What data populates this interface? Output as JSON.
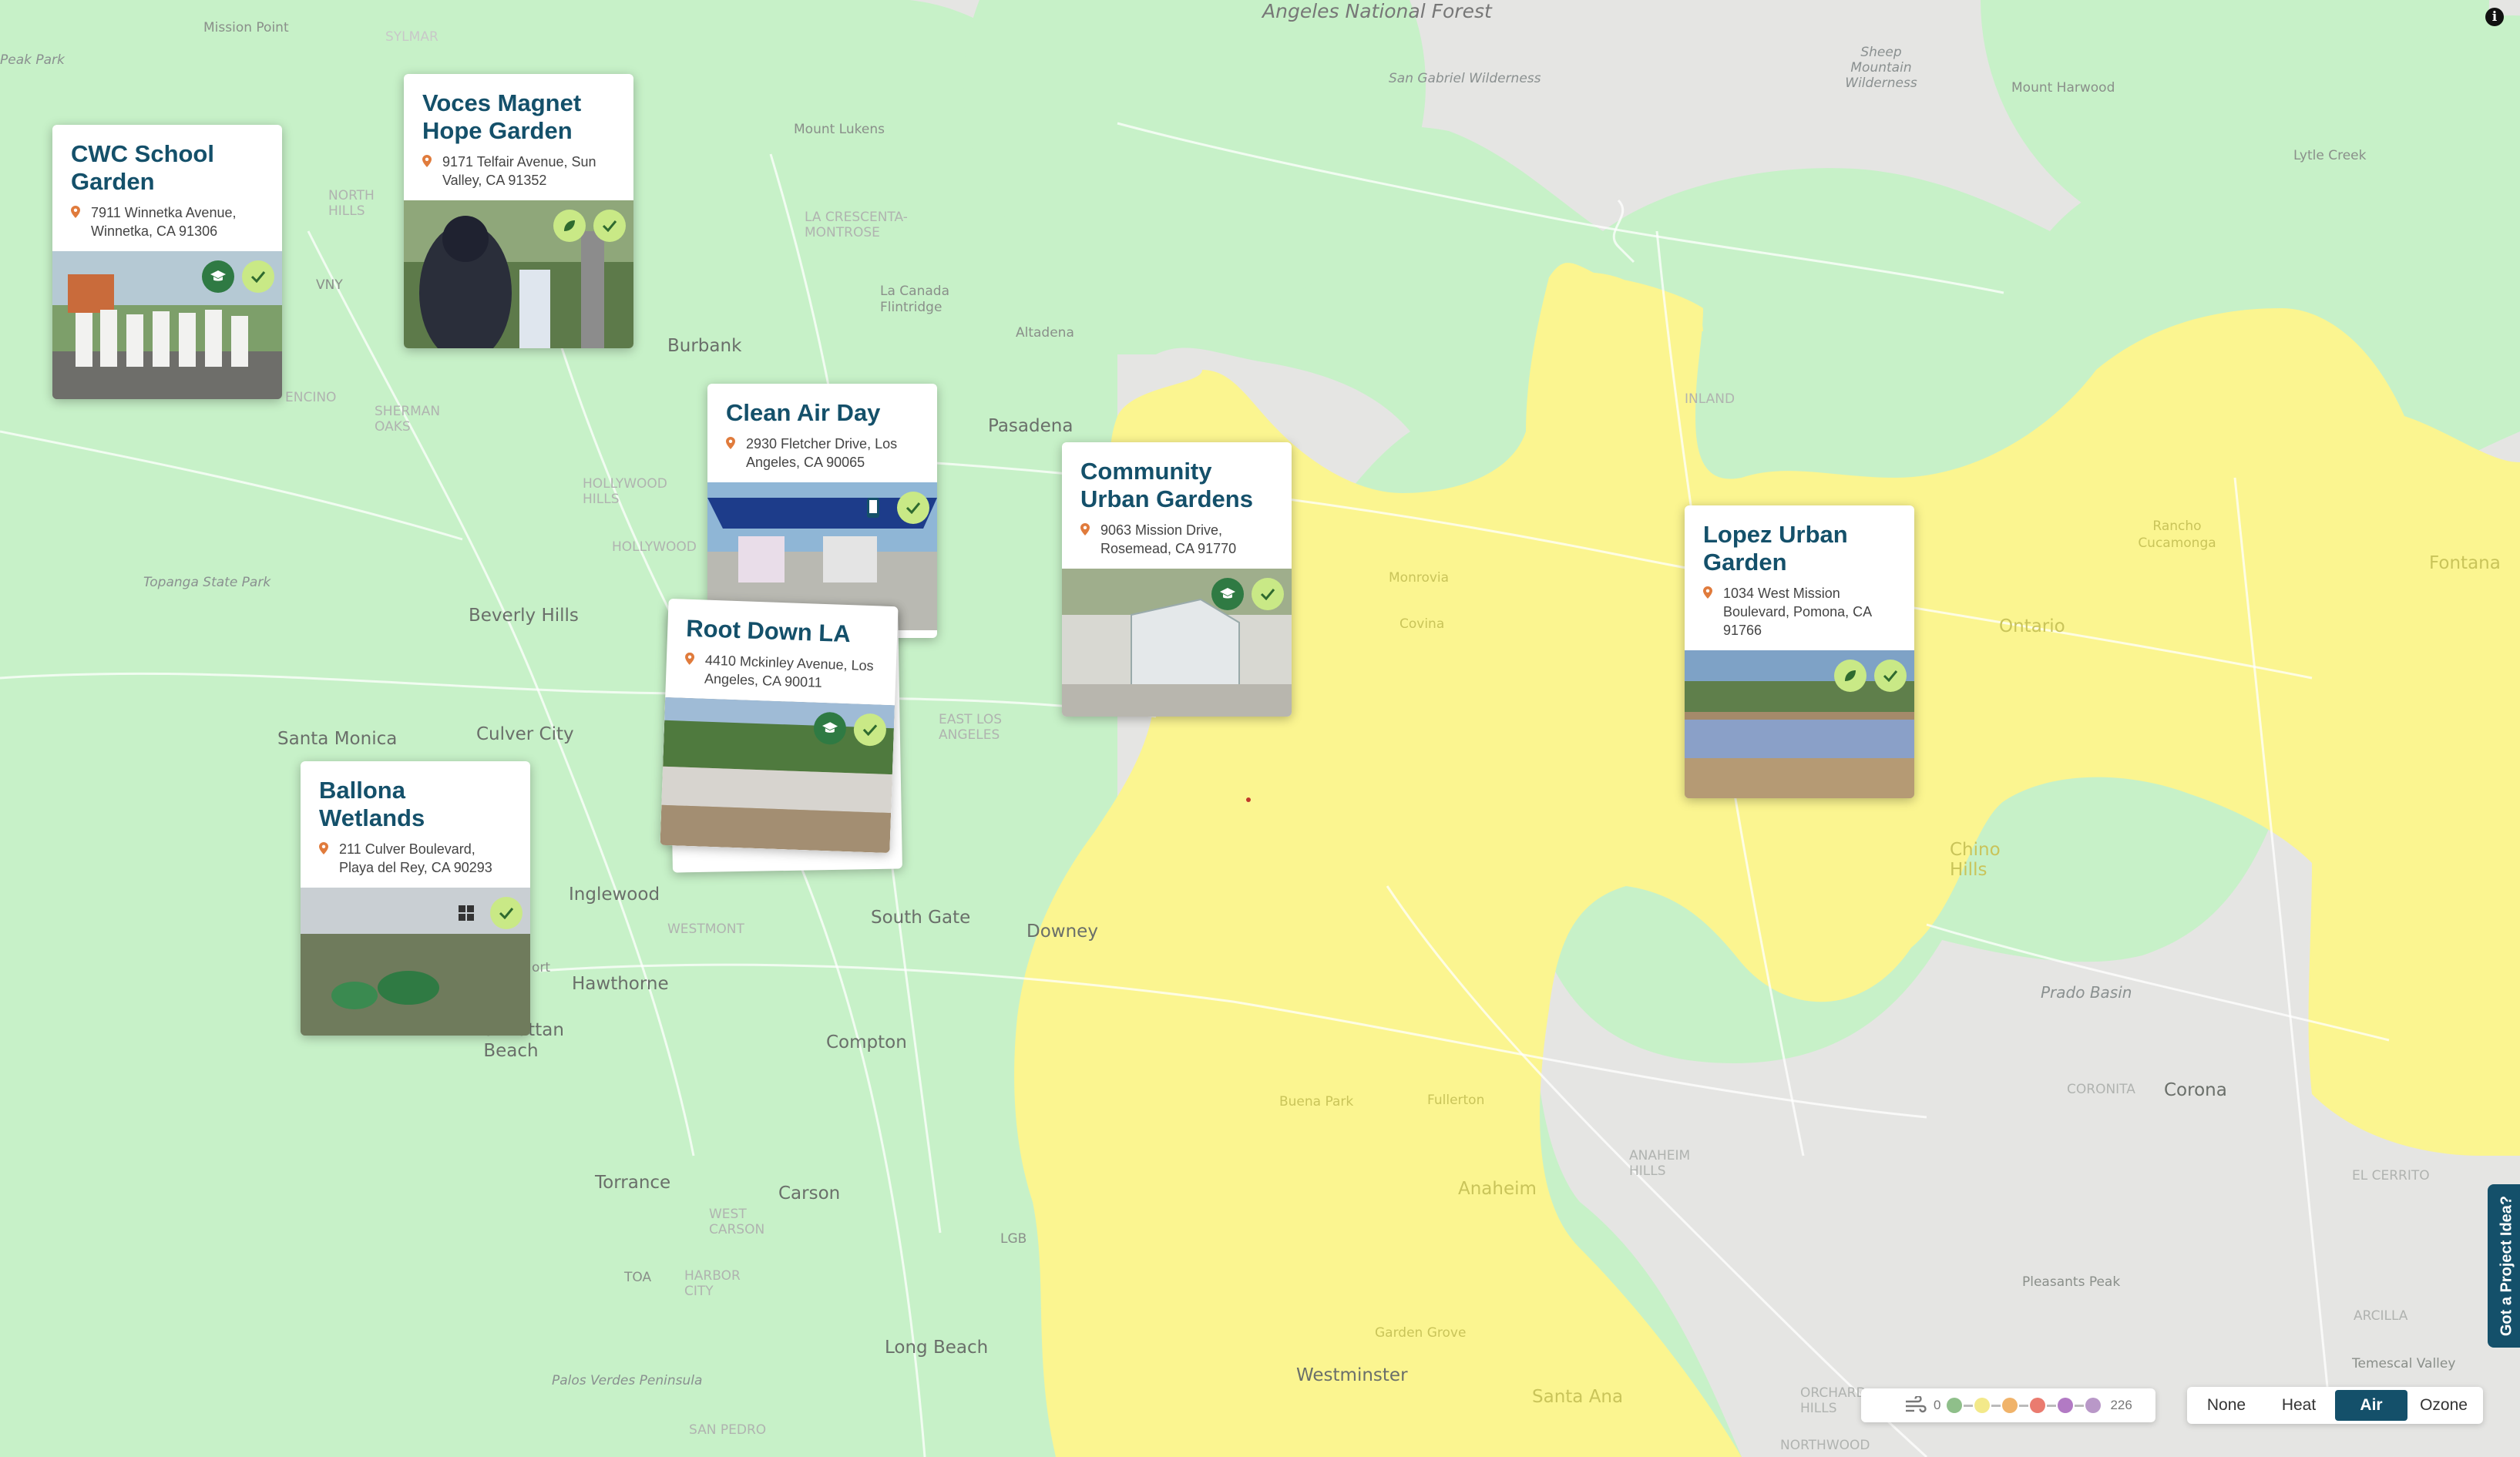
{
  "map": {
    "layer_colors": {
      "good": "#c7f1c8",
      "moderate": "#fbf590",
      "land": "#e5e5e3",
      "water": "#d6d6d6",
      "roads": "#ffffff"
    },
    "places": [
      {
        "id": "angeles",
        "text": "Angeles National Forest"
      },
      {
        "id": "mission_point",
        "text": "Mission Point"
      },
      {
        "id": "peak_park",
        "text": "Peak Park"
      },
      {
        "id": "sylmar",
        "text": "SYLMAR"
      },
      {
        "id": "san_gabriel",
        "text": "San Gabriel Wilderness"
      },
      {
        "id": "sheep_mtn",
        "text": "Sheep Mountain Wilderness"
      },
      {
        "id": "mt_harwood",
        "text": "Mount Harwood"
      },
      {
        "id": "lytle",
        "text": "Lytle Creek"
      },
      {
        "id": "mt_lukens",
        "text": "Mount Lukens"
      },
      {
        "id": "la_crescenta",
        "text": "LA CRESCENTA- MONTROSE"
      },
      {
        "id": "north_hills",
        "text": "NORTH HILLS"
      },
      {
        "id": "vny",
        "text": "VNY"
      },
      {
        "id": "la_canada",
        "text": "La Canada Flintridge"
      },
      {
        "id": "altadena",
        "text": "Altadena"
      },
      {
        "id": "burbank",
        "text": "Burbank"
      },
      {
        "id": "sherman",
        "text": "SHERMAN OAKS"
      },
      {
        "id": "encino",
        "text": "ENCINO"
      },
      {
        "id": "pasadena",
        "text": "Pasadena"
      },
      {
        "id": "hollywood_hills",
        "text": "HOLLYWOOD HILLS"
      },
      {
        "id": "hollywood",
        "text": "HOLLYWOOD"
      },
      {
        "id": "topanga",
        "text": "Topanga State Park"
      },
      {
        "id": "beverly",
        "text": "Beverly Hills"
      },
      {
        "id": "santa_monica",
        "text": "Santa Monica"
      },
      {
        "id": "culver",
        "text": "Culver City"
      },
      {
        "id": "east_la",
        "text": "EAST LOS ANGELES"
      },
      {
        "id": "inglewood",
        "text": "Inglewood"
      },
      {
        "id": "westmont",
        "text": "WESTMONT"
      },
      {
        "id": "south_gate",
        "text": "South Gate"
      },
      {
        "id": "downey",
        "text": "Downey"
      },
      {
        "id": "hawthorne",
        "text": "Hawthorne"
      },
      {
        "id": "manhattan",
        "text": "Manhattan Beach"
      },
      {
        "id": "compton",
        "text": "Compton"
      },
      {
        "id": "torrance",
        "text": "Torrance"
      },
      {
        "id": "carson",
        "text": "Carson"
      },
      {
        "id": "west_carson",
        "text": "WEST CARSON"
      },
      {
        "id": "harbor_city",
        "text": "HARBOR CITY"
      },
      {
        "id": "toa",
        "text": "TOA"
      },
      {
        "id": "lgb",
        "text": "LGB"
      },
      {
        "id": "long_beach",
        "text": "Long Beach"
      },
      {
        "id": "palos_verdes",
        "text": "Palos Verdes Peninsula"
      },
      {
        "id": "san_pedro",
        "text": "SAN PEDRO"
      },
      {
        "id": "westminster",
        "text": "Westminster"
      },
      {
        "id": "rancho",
        "text": "Rancho Cucamonga"
      },
      {
        "id": "fontana",
        "text": "Fontana"
      },
      {
        "id": "ontario",
        "text": "Ontario"
      },
      {
        "id": "chino_hills",
        "text": "Chino Hills"
      },
      {
        "id": "prado",
        "text": "Prado Basin"
      },
      {
        "id": "corona",
        "text": "Corona"
      },
      {
        "id": "coronita",
        "text": "CORONITA"
      },
      {
        "id": "anaheim_hills",
        "text": "ANAHEIM HILLS"
      },
      {
        "id": "el_cerrito",
        "text": "EL CERRITO"
      },
      {
        "id": "anaheim",
        "text": "Anaheim"
      },
      {
        "id": "garden_grove",
        "text": "Garden Grove"
      },
      {
        "id": "santa_ana",
        "text": "Santa Ana"
      },
      {
        "id": "pleasants",
        "text": "Pleasants Peak"
      },
      {
        "id": "temescal",
        "text": "Temescal Valley"
      },
      {
        "id": "arcilla",
        "text": "ARCILLA"
      },
      {
        "id": "orchard",
        "text": "ORCHARD HILLS"
      },
      {
        "id": "northwood",
        "text": "NORTHWOOD"
      },
      {
        "id": "inland",
        "text": "INLAND"
      },
      {
        "id": "monrovia",
        "text": "Monrovia"
      },
      {
        "id": "covina",
        "text": "Covina"
      },
      {
        "id": "fullerton",
        "text": "Fullerton"
      },
      {
        "id": "buena",
        "text": "Buena Park"
      },
      {
        "id": "ort",
        "text": "ort"
      }
    ]
  },
  "cards": [
    {
      "id": "cwc",
      "title": "CWC School Garden",
      "address": "7911 Winnetka Avenue, Winnetka, CA 91306",
      "badges": [
        "school",
        "check"
      ]
    },
    {
      "id": "voces",
      "title": "Voces Magnet Hope Garden",
      "address": "9171 Telfair Avenue, Sun Valley, CA 91352",
      "badges": [
        "leaf",
        "check"
      ]
    },
    {
      "id": "cleanair",
      "title": "Clean Air Day",
      "address": "2930 Fletcher Drive, Los Angeles, CA 90065",
      "badges": [
        "phone",
        "check"
      ]
    },
    {
      "id": "community",
      "title": "Community Urban Gardens",
      "address": "9063 Mission Drive, Rosemead, CA 91770",
      "badges": [
        "school",
        "check"
      ]
    },
    {
      "id": "lopez",
      "title": "Lopez Urban Garden",
      "address": "1034 West Mission Boulevard, Pomona, CA 91766",
      "badges": [
        "leaf",
        "check"
      ]
    },
    {
      "id": "rootdown",
      "title": "Root Down LA",
      "address": "4410 Mckinley Avenue, Los Angeles, CA 90011",
      "badges": [
        "school",
        "check"
      ]
    },
    {
      "id": "ballona",
      "title": "Ballona Wetlands",
      "address": "211 Culver Boulevard, Playa del Rey, CA 90293",
      "badges": [
        "grid",
        "check"
      ]
    }
  ],
  "legend": {
    "min": "0",
    "max": "226",
    "icon": "wind-icon",
    "colors": [
      "#8fbf8a",
      "#f3e98a",
      "#f0b36a",
      "#ea7b6f",
      "#b27ac4",
      "#b998c8"
    ]
  },
  "layer_toggle": {
    "options": [
      "None",
      "Heat",
      "Air",
      "Ozone"
    ],
    "selected": "Air"
  },
  "project_tab": "Got a Project Idea?",
  "info_icon": "info-icon"
}
